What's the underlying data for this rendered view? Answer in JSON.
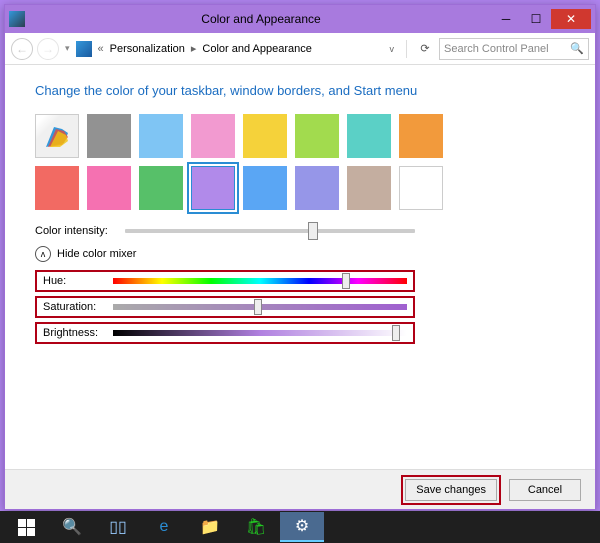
{
  "window": {
    "title": "Color and Appearance",
    "breadcrumb": {
      "p1": "Personalization",
      "p2": "Color and Appearance"
    },
    "search_placeholder": "Search Control Panel"
  },
  "page": {
    "heading": "Change the color of your taskbar, window borders, and Start menu",
    "intensity_label": "Color intensity:",
    "mixer_toggle": "Hide color mixer",
    "hue_label": "Hue:",
    "sat_label": "Saturation:",
    "bri_label": "Brightness:",
    "intensity_value": 63,
    "hue_value": 78,
    "sat_value": 48,
    "bri_value": 95
  },
  "colors": {
    "row1": [
      "auto",
      "#929292",
      "#7fc5f4",
      "#f29ad0",
      "#f5d23a",
      "#a2db4e",
      "#5bd0c6",
      "#f29a3c"
    ],
    "row2": [
      "#f26a63",
      "#f571b1",
      "#57c069",
      "#b18aea",
      "#5aa6f4",
      "#9696e8",
      "#c4aea0",
      "#ffffff"
    ],
    "selected_index": 11
  },
  "buttons": {
    "save": "Save changes",
    "cancel": "Cancel"
  }
}
